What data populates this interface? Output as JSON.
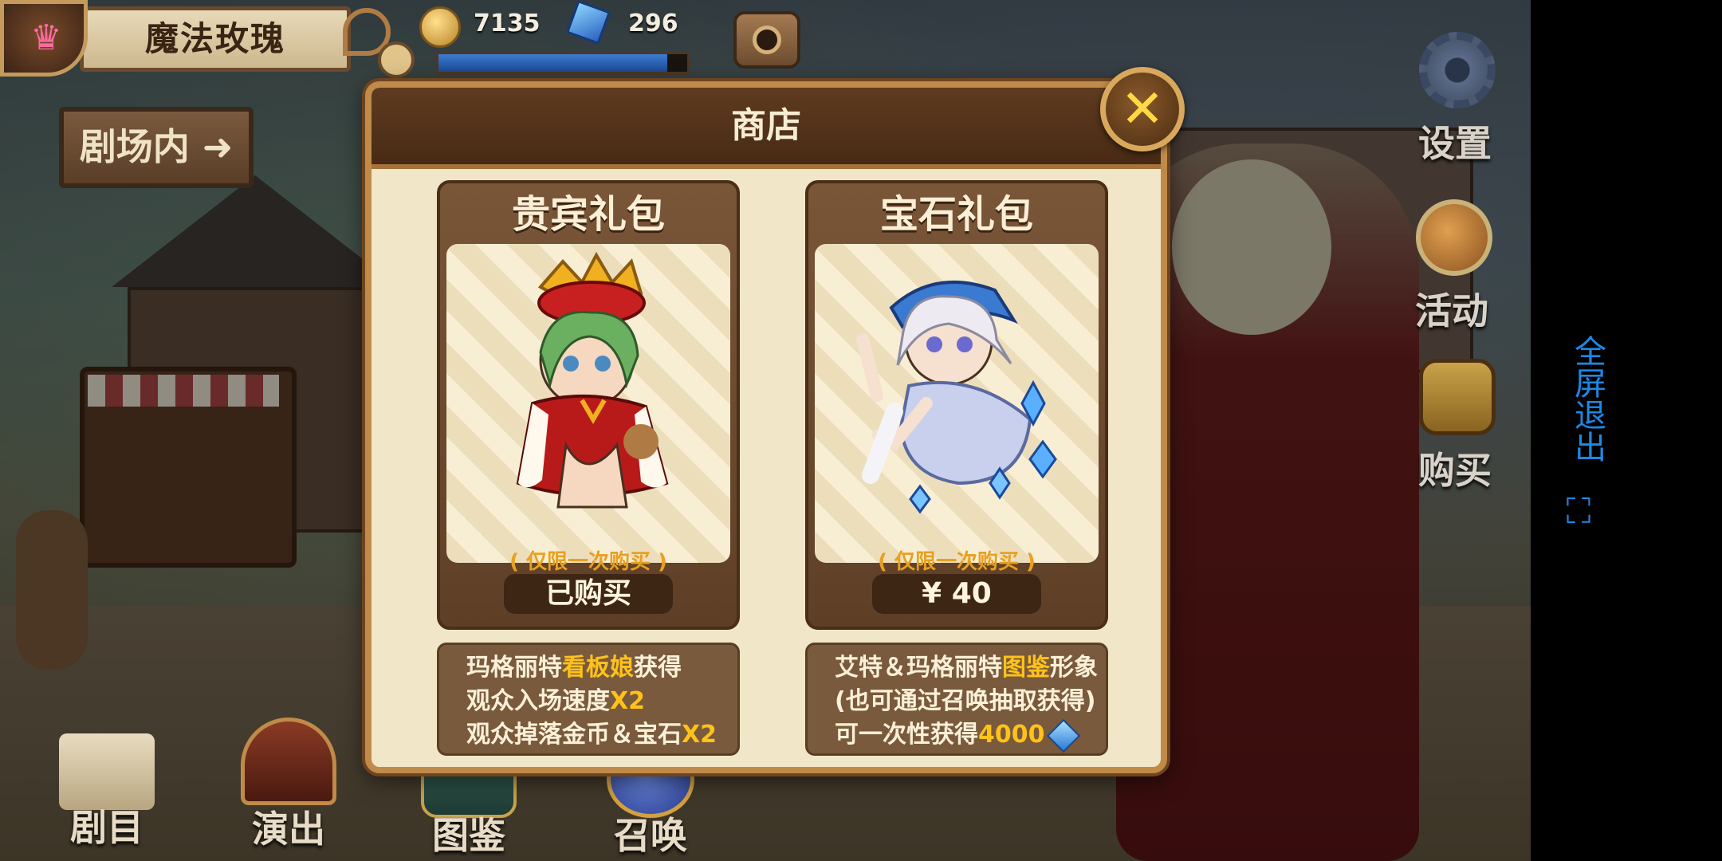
{
  "header": {
    "title": "魔法玫瑰",
    "gold": "7135",
    "gems": "296",
    "progress": 0.92
  },
  "sign": {
    "label": "剧场内 ➜"
  },
  "side_menu": {
    "settings_label": "设置",
    "events_label": "活动",
    "shop_label": "购买"
  },
  "bottom_menu": {
    "repertoire_label": "剧目",
    "performance_label": "演出",
    "codex_label": "图鉴",
    "summon_label": "召唤"
  },
  "store": {
    "title": "商店",
    "close_glyph": "✕",
    "packs": [
      {
        "title": "贵宾礼包",
        "limit": "( 仅限一次购买 )",
        "price": "已购买",
        "desc": [
          {
            "pre": "玛格丽特",
            "hl": "看板娘",
            "post": "获得"
          },
          {
            "pre": "观众入场速度",
            "hl": "X2",
            "post": ""
          },
          {
            "pre": "观众掉落金币＆宝石",
            "hl": "X2",
            "post": ""
          }
        ]
      },
      {
        "title": "宝石礼包",
        "limit": "( 仅限一次购买 )",
        "price": "¥ 40",
        "desc": [
          {
            "pre": "艾特＆玛格丽特",
            "hl": "图鉴",
            "post": "形象"
          },
          {
            "pre": "(也可通过召唤抽取获得)",
            "hl": "",
            "post": ""
          },
          {
            "pre": "可一次性获得",
            "hl": "4000",
            "post": ""
          }
        ]
      }
    ]
  },
  "overlay": {
    "strip_text": "全屏退出",
    "expand_glyph": "⛶"
  },
  "colors": {
    "accent_gold": "#ffc21a",
    "panel_brown": "#5e3b20",
    "overlay_blue": "#1e88e5"
  }
}
